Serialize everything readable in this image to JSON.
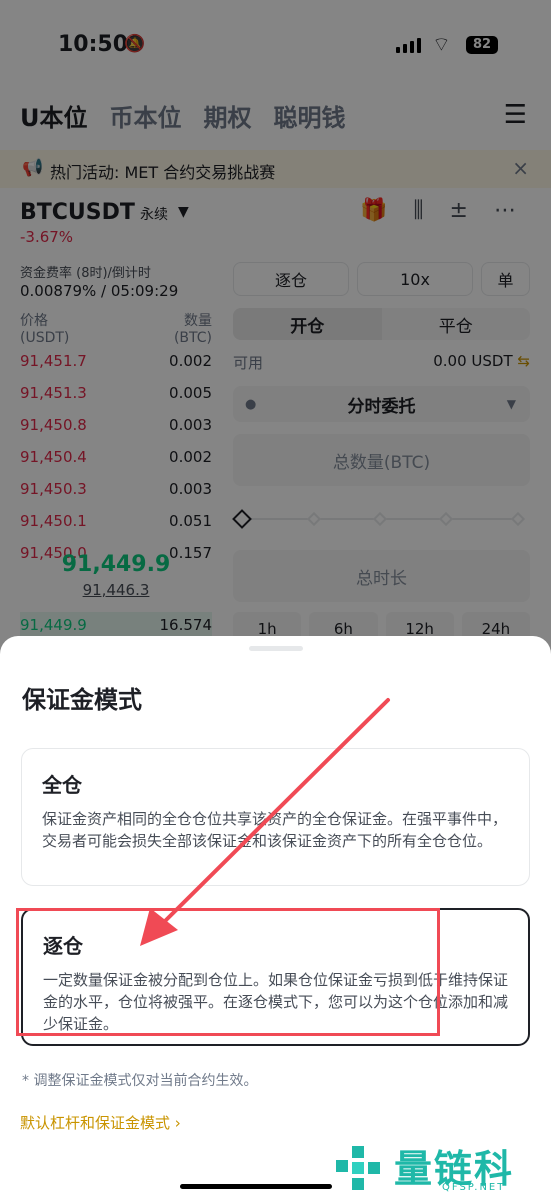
{
  "status_bar": {
    "time": "10:50",
    "battery": "82"
  },
  "tabs": [
    "U本位",
    "币本位",
    "期权",
    "聪明钱"
  ],
  "promo": {
    "text": "热门活动: MET 合约交易挑战赛"
  },
  "pair": {
    "symbol": "BTCUSDT",
    "type": "永续",
    "change": "-3.67%"
  },
  "funding": {
    "label": "资金费率 (8时)/倒计时",
    "value": "0.00879% / 05:09:29"
  },
  "orderbook": {
    "col_price": "价格",
    "col_price_unit": "(USDT)",
    "col_qty": "数量",
    "col_qty_unit": "(BTC)",
    "asks": [
      {
        "price": "91,451.7",
        "qty": "0.002"
      },
      {
        "price": "91,451.3",
        "qty": "0.005"
      },
      {
        "price": "91,450.8",
        "qty": "0.003"
      },
      {
        "price": "91,450.4",
        "qty": "0.002"
      },
      {
        "price": "91,450.3",
        "qty": "0.003"
      },
      {
        "price": "91,450.1",
        "qty": "0.051"
      },
      {
        "price": "91,450.0",
        "qty": "0.157"
      }
    ],
    "last_price": "91,449.9",
    "mark_price": "91,446.3",
    "bid": {
      "price": "91,449.9",
      "qty": "16.574"
    }
  },
  "order_form": {
    "margin_mode": "逐仓",
    "leverage": "10x",
    "side_mode": "单",
    "open": "开仓",
    "close": "平仓",
    "available_label": "可用",
    "available_value": "0.00 USDT",
    "order_type": "分时委托",
    "total_qty_placeholder": "总数量(BTC)",
    "total_duration_placeholder": "总时长",
    "durations": [
      "1h",
      "6h",
      "12h",
      "24h"
    ]
  },
  "sheet": {
    "title": "保证金模式",
    "cross": {
      "title": "全仓",
      "desc": "保证金资产相同的全仓仓位共享该资产的全仓保证金。在强平事件中，交易者可能会损失全部该保证金和该保证金资产下的所有全仓仓位。"
    },
    "isolated": {
      "title": "逐仓",
      "desc": "一定数量保证金被分配到仓位上。如果仓位保证金亏损到低于维持保证金的水平，仓位将被强平。在逐仓模式下，您可以为这个仓位添加和减少保证金。"
    },
    "note": "* 调整保证金模式仅对当前合约生效。",
    "link": "默认杠杆和保证金模式"
  },
  "watermark": {
    "brand": "量链科技",
    "site": "QFSP.NET"
  },
  "colors": {
    "accent": "#c99400",
    "down": "#e0294a",
    "up": "#0ecb81",
    "annotation": "#f04a55"
  }
}
